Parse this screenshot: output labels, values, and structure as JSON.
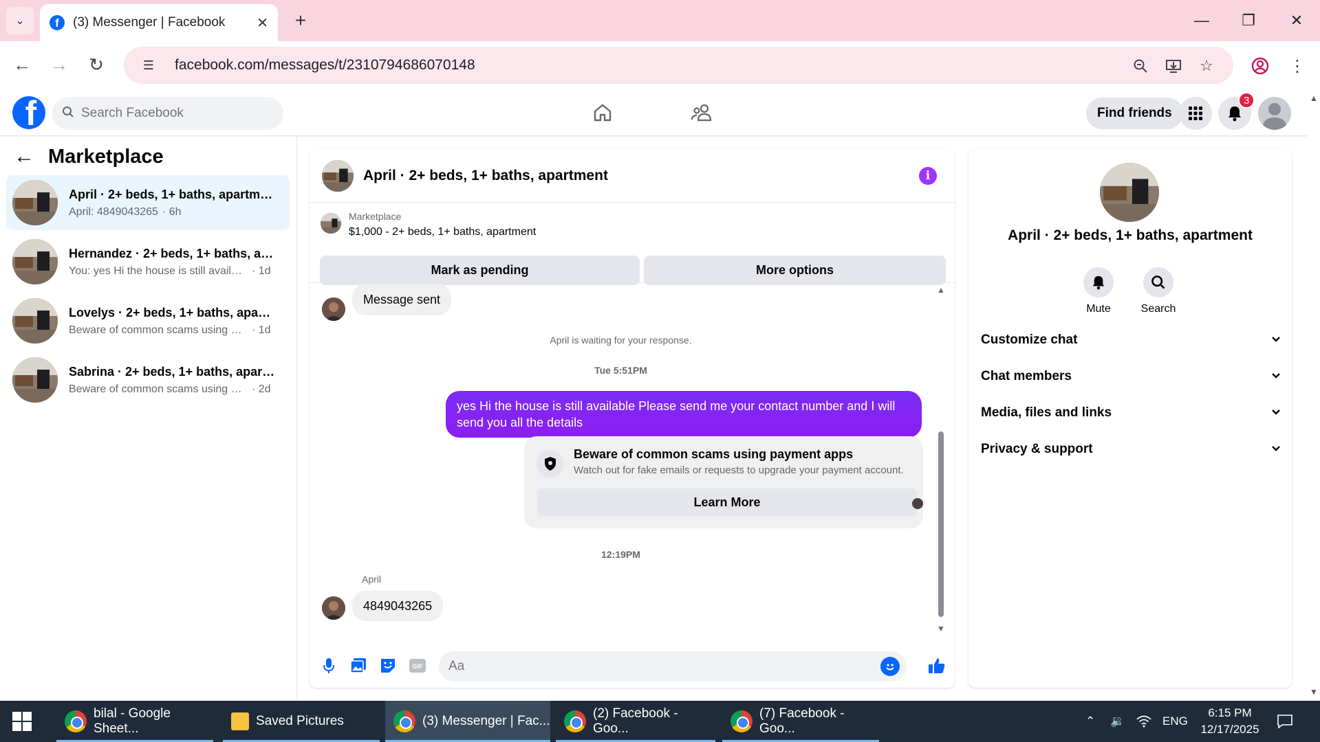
{
  "browser": {
    "tab_title": "(3) Messenger | Facebook",
    "url": "facebook.com/messages/t/2310794686070148"
  },
  "fb_header": {
    "search_placeholder": "Search Facebook",
    "find_friends_label": "Find friends",
    "notification_count": "3"
  },
  "sidebar": {
    "title": "Marketplace",
    "chats": [
      {
        "name": "April · 2+ beds, 1+ baths, apartment",
        "preview": "April: 4849043265",
        "time": "· 6h",
        "active": true
      },
      {
        "name": "Hernandez · 2+ beds, 1+ baths, ap...",
        "preview": "You: yes Hi the house is still available ...",
        "time": "· 1d",
        "active": false
      },
      {
        "name": "Lovelys · 2+ beds, 1+ baths, apart...",
        "preview": "Beware of common scams using pay...",
        "time": "· 1d",
        "active": false
      },
      {
        "name": "Sabrina · 2+ beds, 1+ baths, apart...",
        "preview": "Beware of common scams using pay...",
        "time": "· 2d",
        "active": false
      }
    ]
  },
  "conversation": {
    "title": "April · 2+ beds, 1+ baths, apartment",
    "marketplace_label": "Marketplace",
    "listing": "$1,000 - 2+ beds, 1+ baths, apartment",
    "mark_pending_label": "Mark as pending",
    "more_options_label": "More options",
    "messages": {
      "message_sent": "Message sent",
      "waiting_notice": "April is waiting for your response.",
      "time_1": "Tue 5:51PM",
      "outgoing": "yes Hi the house is still available Please send me your contact number and I will send you all the details",
      "scam_title": "Beware of common scams using payment apps",
      "scam_subtitle": "Watch out for fake emails or requests to upgrade your payment account.",
      "learn_more_label": "Learn More",
      "time_2": "12:19PM",
      "sender": "April",
      "incoming": "4849043265"
    },
    "composer_placeholder": "Aa"
  },
  "info_panel": {
    "name": "April · 2+ beds, 1+ baths, apartment",
    "mute_label": "Mute",
    "search_label": "Search",
    "sections": [
      "Customize chat",
      "Chat members",
      "Media, files and links",
      "Privacy & support"
    ]
  },
  "taskbar": {
    "items": [
      "bilal - Google Sheet...",
      "Saved Pictures",
      "(3) Messenger | Fac...",
      "(2) Facebook - Goo...",
      "(7) Facebook - Goo..."
    ],
    "language": "ENG",
    "time": "6:15 PM",
    "date": "12/17/2025"
  },
  "colors": {
    "brand_blue": "#0866ff",
    "outgoing_bubble": "#8b1df0",
    "tabbar_pink": "#f9d6df"
  }
}
